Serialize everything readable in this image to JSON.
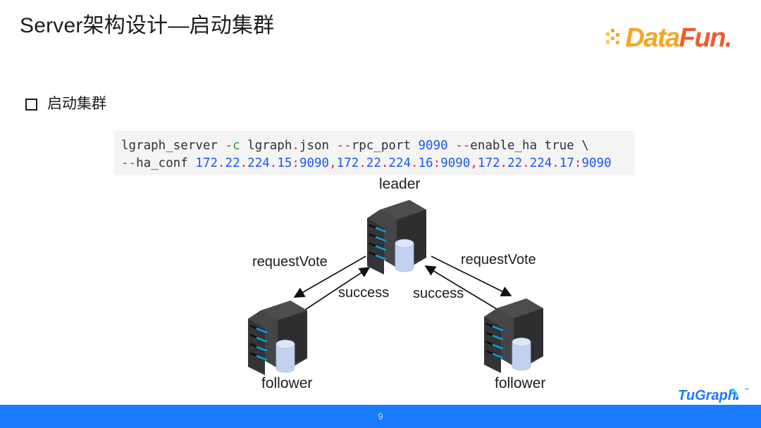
{
  "slide": {
    "title": "Server架构设计—启动集群",
    "page_number": "9",
    "accent_color": "#1a7afc"
  },
  "branding": {
    "datafun": {
      "part1": "Data",
      "part2": "Fun.",
      "color1": "#f5a623",
      "color2": "#ef5b2b"
    },
    "tugraph": {
      "text": "TuGraph",
      "trademark": "™",
      "color": "#1a7afc"
    }
  },
  "bullet": {
    "marker": "hollow-square",
    "text": "启动集群"
  },
  "code": {
    "background": "#f4f4f4",
    "line1": [
      {
        "t": "lgraph_server ",
        "c": "plain"
      },
      {
        "t": "-",
        "c": "red"
      },
      {
        "t": "c",
        "c": "green"
      },
      {
        "t": " lgraph",
        "c": "plain"
      },
      {
        "t": ".",
        "c": "red"
      },
      {
        "t": "json ",
        "c": "plain"
      },
      {
        "t": "--",
        "c": "red"
      },
      {
        "t": "rpc_port ",
        "c": "plain"
      },
      {
        "t": "9090",
        "c": "blue"
      },
      {
        "t": " ",
        "c": "plain"
      },
      {
        "t": "--",
        "c": "red"
      },
      {
        "t": "enable_ha true \\",
        "c": "plain"
      }
    ],
    "line2": [
      {
        "t": "--",
        "c": "red"
      },
      {
        "t": "ha_conf ",
        "c": "plain"
      },
      {
        "t": "172",
        "c": "blue"
      },
      {
        "t": ".",
        "c": "red"
      },
      {
        "t": "22",
        "c": "blue"
      },
      {
        "t": ".",
        "c": "red"
      },
      {
        "t": "224",
        "c": "blue"
      },
      {
        "t": ".",
        "c": "red"
      },
      {
        "t": "15",
        "c": "blue"
      },
      {
        "t": ":",
        "c": "red"
      },
      {
        "t": "9090",
        "c": "blue"
      },
      {
        "t": ",",
        "c": "red"
      },
      {
        "t": "172",
        "c": "blue"
      },
      {
        "t": ".",
        "c": "red"
      },
      {
        "t": "22",
        "c": "blue"
      },
      {
        "t": ".",
        "c": "red"
      },
      {
        "t": "224",
        "c": "blue"
      },
      {
        "t": ".",
        "c": "red"
      },
      {
        "t": "16",
        "c": "blue"
      },
      {
        "t": ":",
        "c": "red"
      },
      {
        "t": "9090",
        "c": "blue"
      },
      {
        "t": ",",
        "c": "red"
      },
      {
        "t": "172",
        "c": "blue"
      },
      {
        "t": ".",
        "c": "red"
      },
      {
        "t": "22",
        "c": "blue"
      },
      {
        "t": ".",
        "c": "red"
      },
      {
        "t": "224",
        "c": "blue"
      },
      {
        "t": ".",
        "c": "red"
      },
      {
        "t": "17",
        "c": "blue"
      },
      {
        "t": ":",
        "c": "red"
      },
      {
        "t": "9090",
        "c": "blue"
      }
    ],
    "plain_text_line1": "lgraph_server -c lgraph.json --rpc_port 9090 --enable_ha true \\",
    "plain_text_line2": "--ha_conf 172.22.224.15:9090,172.22.224.16:9090,172.22.224.17:9090"
  },
  "diagram": {
    "nodes": [
      {
        "id": "leader",
        "label": "leader",
        "role": "leader"
      },
      {
        "id": "follower_l",
        "label": "follower",
        "role": "follower"
      },
      {
        "id": "follower_r",
        "label": "follower",
        "role": "follower"
      }
    ],
    "edges": [
      {
        "from": "leader",
        "to": "follower_l",
        "label": "requestVote"
      },
      {
        "from": "leader",
        "to": "follower_r",
        "label": "requestVote"
      },
      {
        "from": "follower_l",
        "to": "leader",
        "label": "success"
      },
      {
        "from": "follower_r",
        "to": "leader",
        "label": "success"
      }
    ],
    "server_colors": {
      "body_dark": "#3a3a3c",
      "body_side": "#2b2b2d",
      "body_top": "#4a4a4c",
      "led": "#0d9ddb",
      "db_fill": "#c3d3ef",
      "db_top": "#dde6f7"
    }
  }
}
